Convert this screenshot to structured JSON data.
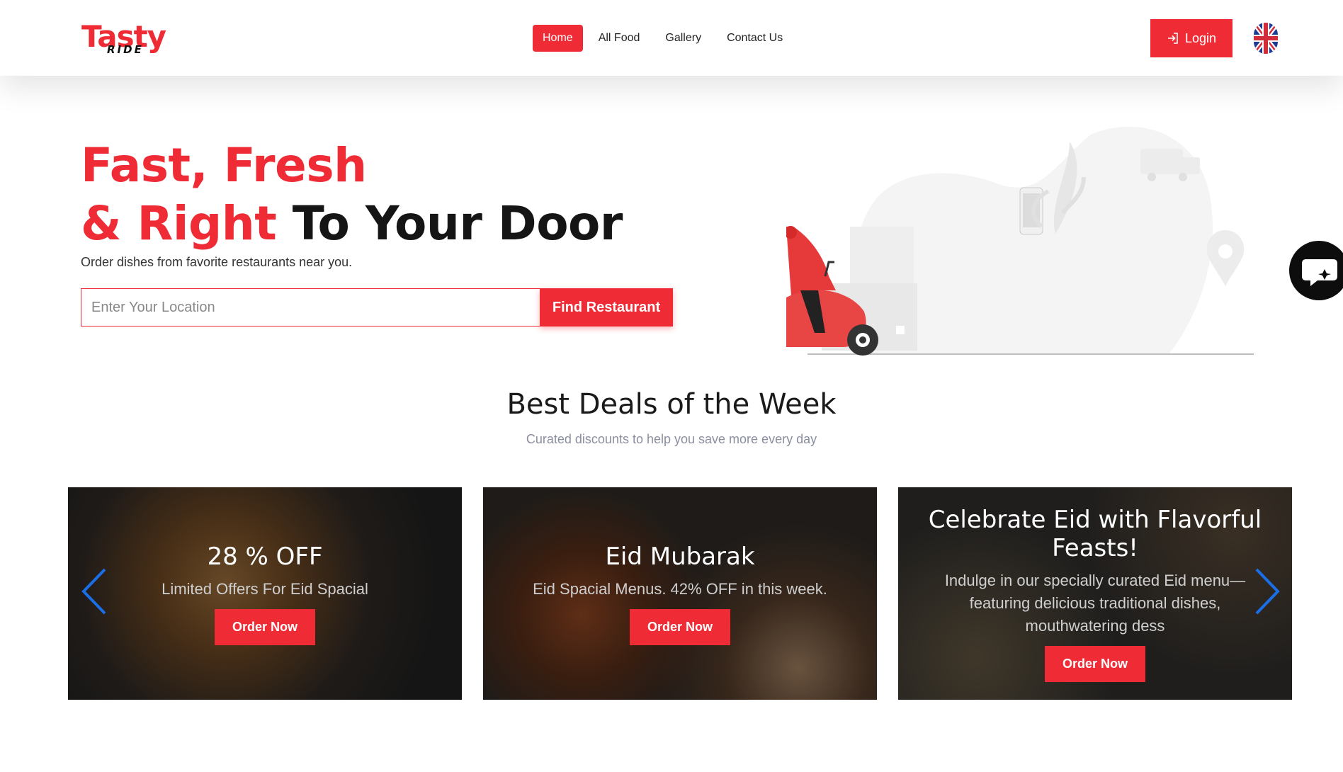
{
  "brand": {
    "name": "Tasty",
    "tagline": "RIDE"
  },
  "nav": {
    "items": [
      {
        "label": "Home",
        "active": true
      },
      {
        "label": "All Food",
        "active": false
      },
      {
        "label": "Gallery",
        "active": false
      },
      {
        "label": "Contact Us",
        "active": false
      }
    ]
  },
  "header": {
    "login_label": "Login",
    "language_icon": "uk-flag-icon"
  },
  "hero": {
    "title_part1": "Fast, Fresh",
    "title_part2_red": "& Right",
    "title_part2_dark": " To Your Door",
    "subtitle": "Order dishes from favorite restaurants near you.",
    "search_placeholder": "Enter Your Location",
    "search_button": "Find Restaurant"
  },
  "deals": {
    "title": "Best Deals of the Week",
    "subtitle": "Curated discounts to help you save more every day",
    "cards": [
      {
        "title": "28 % OFF",
        "desc": "Limited Offers For Eid Spacial",
        "button": "Order Now"
      },
      {
        "title": "Eid Mubarak",
        "desc": "Eid Spacial Menus. 42% OFF in this week.",
        "button": "Order Now"
      },
      {
        "title": "Celebrate Eid with Flavorful Feasts!",
        "desc": "Indulge in our specially curated Eid menu—featuring delicious traditional dishes, mouthwatering dess",
        "button": "Order Now"
      }
    ]
  },
  "colors": {
    "accent": "#ef2c35",
    "arrow": "#1a6fe8",
    "dark": "#151515"
  }
}
